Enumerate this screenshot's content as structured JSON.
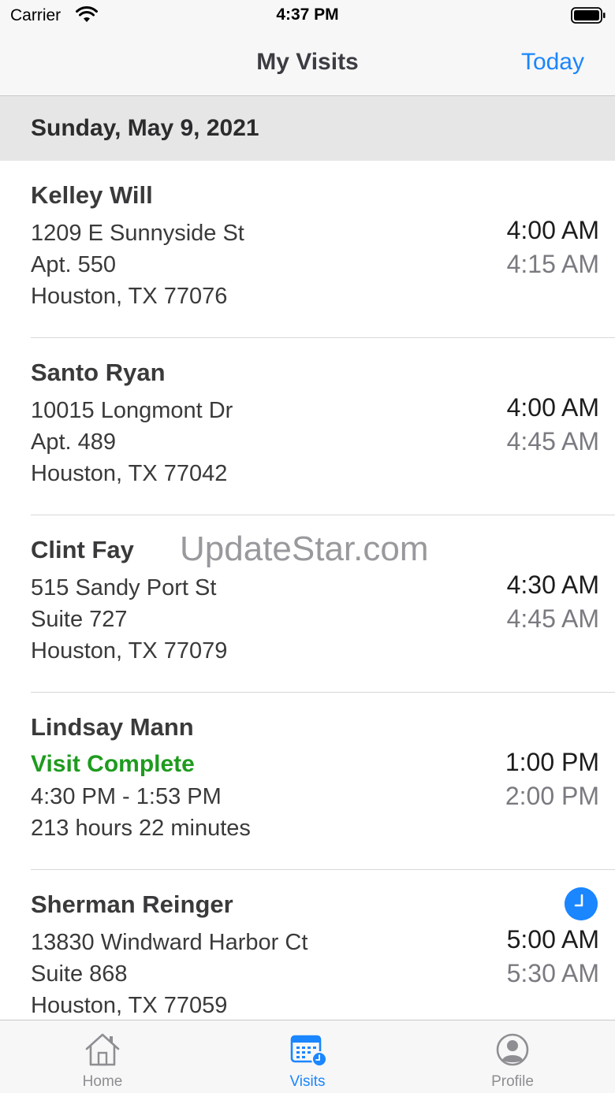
{
  "status_bar": {
    "carrier": "Carrier",
    "time": "4:37 PM"
  },
  "nav": {
    "title": "My Visits",
    "today_label": "Today"
  },
  "section": {
    "date": "Sunday, May 9, 2021"
  },
  "visits": [
    {
      "name": "Kelley Will",
      "line1": "1209 E Sunnyside St",
      "line2": "Apt. 550",
      "line3": "Houston, TX 77076",
      "start": "4:00 AM",
      "end": "4:15 AM"
    },
    {
      "name": "Santo Ryan",
      "line1": "10015 Longmont Dr",
      "line2": "Apt. 489",
      "line3": "Houston, TX 77042",
      "start": "4:00 AM",
      "end": "4:45 AM"
    },
    {
      "name": "Clint Fay",
      "line1": "515 Sandy Port St",
      "line2": "Suite 727",
      "line3": "Houston, TX 77079",
      "start": "4:30 AM",
      "end": "4:45 AM"
    },
    {
      "name": "Lindsay Mann",
      "status": "Visit Complete",
      "line2": "4:30 PM - 1:53 PM",
      "line3": "213 hours 22 minutes",
      "start": "1:00 PM",
      "end": "2:00 PM"
    },
    {
      "name": "Sherman Reinger",
      "line1": "13830 Windward Harbor Ct",
      "line2": "Suite 868",
      "line3": "Houston, TX 77059",
      "start": "5:00 AM",
      "end": "5:30 AM",
      "badge_icon": "clock-icon"
    }
  ],
  "watermark": "UpdateStar.com",
  "tabs": [
    {
      "label": "Home",
      "icon": "home-icon",
      "active": false
    },
    {
      "label": "Visits",
      "icon": "calendar-icon",
      "active": true
    },
    {
      "label": "Profile",
      "icon": "person-icon",
      "active": false
    }
  ],
  "colors": {
    "accent": "#1a86ff",
    "complete": "#1e9b1e",
    "secondary_text": "#7a7a80",
    "section_bg": "#e6e6e6"
  }
}
